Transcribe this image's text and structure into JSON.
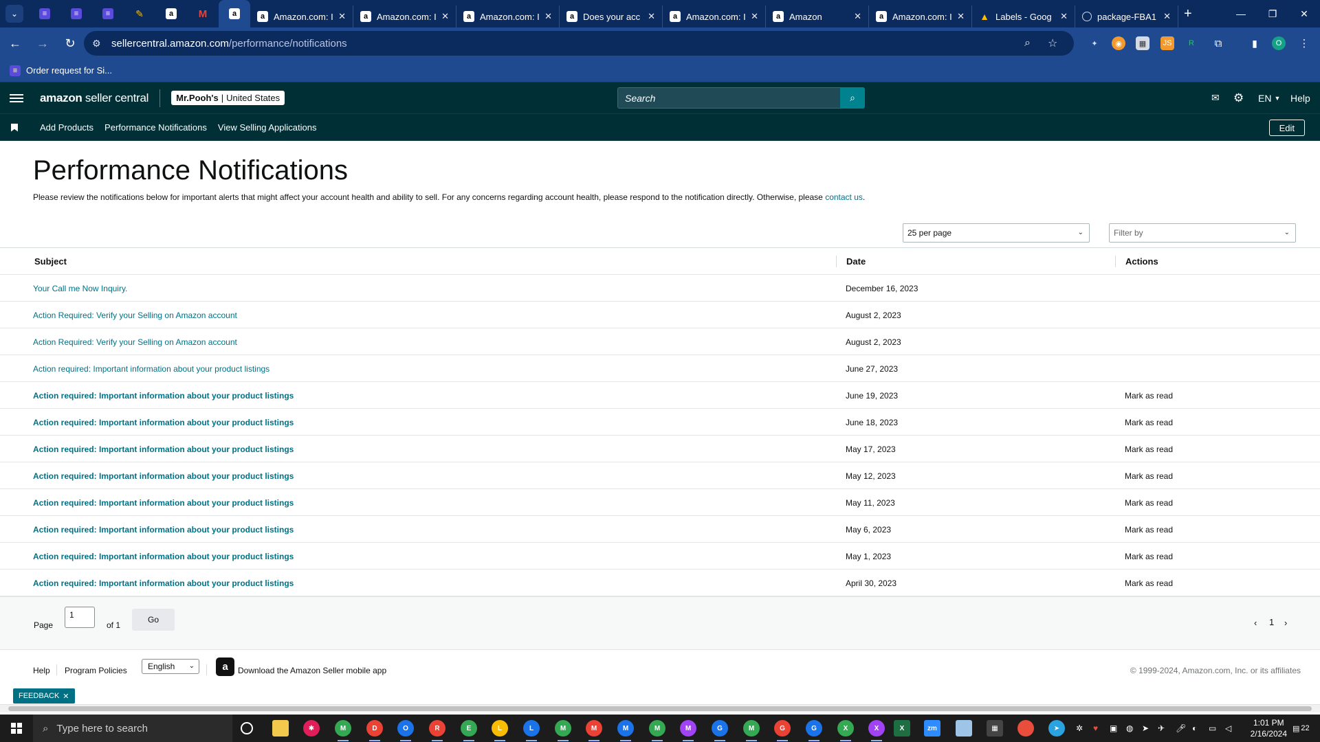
{
  "browser": {
    "pinned_tabs": [
      {
        "icon": "sheets-icon"
      },
      {
        "icon": "sheets-icon"
      },
      {
        "icon": "sheets-icon"
      },
      {
        "icon": "pencil-app-icon"
      },
      {
        "icon": "amazon-icon"
      },
      {
        "icon": "gmail-icon"
      },
      {
        "icon": "amazon-icon"
      }
    ],
    "tabs": [
      {
        "title": "Amazon.com: I",
        "icon": "amazon-icon"
      },
      {
        "title": "Amazon.com: I",
        "icon": "amazon-icon"
      },
      {
        "title": "Amazon.com: I",
        "icon": "amazon-icon"
      },
      {
        "title": "Does your acc",
        "icon": "amazon-icon"
      },
      {
        "title": "Amazon.com: I",
        "icon": "amazon-icon"
      },
      {
        "title": "Amazon",
        "icon": "amazon-icon"
      },
      {
        "title": "Amazon.com: I",
        "icon": "amazon-icon"
      },
      {
        "title": "Labels - Goog",
        "icon": "drive-icon"
      },
      {
        "title": "package-FBA1",
        "icon": "globe-icon"
      }
    ],
    "url_host": "sellercentral.amazon.com",
    "url_path": "/performance/notifications",
    "profile_initial": "O",
    "bookmark": "Order request for Si..."
  },
  "header": {
    "logo_bold": "amazon",
    "logo_light": " seller central",
    "store_name": "Mr.Pooh's",
    "store_sep": "|",
    "store_region": "United States",
    "search_placeholder": "Search",
    "language": "EN",
    "help": "Help"
  },
  "subnav": {
    "links": [
      "Add Products",
      "Performance Notifications",
      "View Selling Applications"
    ],
    "edit": "Edit"
  },
  "page": {
    "title": "Performance Notifications",
    "description": "Please review the notifications below for important alerts that might affect your account health and ability to sell. For any concerns regarding account health, please respond to the notification directly. Otherwise, please ",
    "contact_link": "contact us",
    "description_end": ".",
    "per_page": "25 per page",
    "filter_placeholder": "Filter by"
  },
  "table": {
    "headers": {
      "subject": "Subject",
      "date": "Date",
      "actions": "Actions"
    },
    "rows": [
      {
        "subject": "Your Call me Now Inquiry.",
        "date": "December 16, 2023",
        "action": "",
        "unread": false
      },
      {
        "subject": "Action Required: Verify your Selling on Amazon account",
        "date": "August 2, 2023",
        "action": "",
        "unread": false
      },
      {
        "subject": "Action Required: Verify your Selling on Amazon account",
        "date": "August 2, 2023",
        "action": "",
        "unread": false
      },
      {
        "subject": "Action required: Important information about your product listings",
        "date": "June 27, 2023",
        "action": "",
        "unread": false
      },
      {
        "subject": "Action required: Important information about your product listings",
        "date": "June 19, 2023",
        "action": "Mark as read",
        "unread": true
      },
      {
        "subject": "Action required: Important information about your product listings",
        "date": "June 18, 2023",
        "action": "Mark as read",
        "unread": true
      },
      {
        "subject": "Action required: Important information about your product listings",
        "date": "May 17, 2023",
        "action": "Mark as read",
        "unread": true
      },
      {
        "subject": "Action required: Important information about your product listings",
        "date": "May 12, 2023",
        "action": "Mark as read",
        "unread": true
      },
      {
        "subject": "Action required: Important information about your product listings",
        "date": "May 11, 2023",
        "action": "Mark as read",
        "unread": true
      },
      {
        "subject": "Action required: Important information about your product listings",
        "date": "May 6, 2023",
        "action": "Mark as read",
        "unread": true
      },
      {
        "subject": "Action required: Important information about your product listings",
        "date": "May 1, 2023",
        "action": "Mark as read",
        "unread": true
      },
      {
        "subject": "Action required: Important information about your product listings",
        "date": "April 30, 2023",
        "action": "Mark as read",
        "unread": true
      }
    ]
  },
  "pagination": {
    "page_label": "Page",
    "page_value": "1",
    "of_label": "of 1",
    "go": "Go",
    "current": "1"
  },
  "footer": {
    "help": "Help",
    "policies": "Program Policies",
    "language": "English",
    "app_text": "Download the Amazon Seller mobile app",
    "copyright": "© 1999-2024, Amazon.com, Inc. or its affiliates",
    "feedback": "FEEDBACK"
  },
  "taskbar": {
    "search_placeholder": "Type here to search",
    "time": "1:01 PM",
    "date": "2/16/2024",
    "notifications": "22"
  },
  "colors": {
    "seller_header": "#002f36",
    "link": "#007185",
    "browser_frame": "#1f4a8f"
  }
}
